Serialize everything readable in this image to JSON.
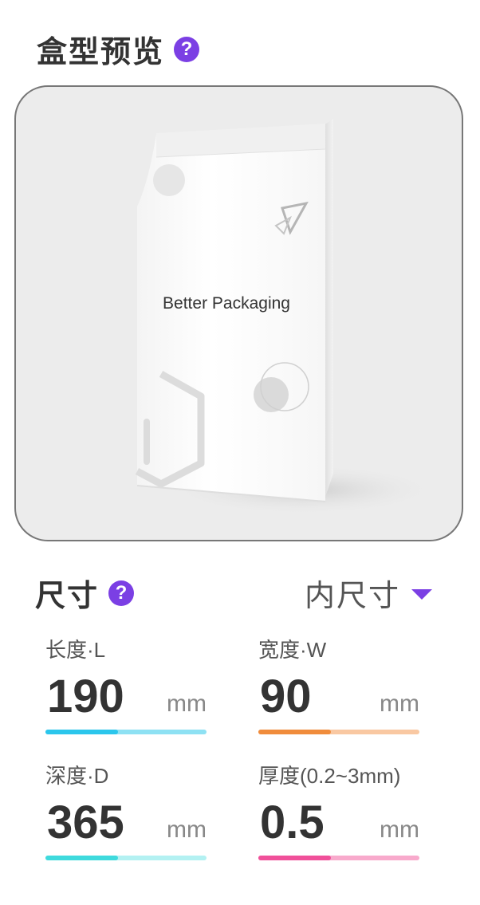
{
  "preview": {
    "title": "盒型预览",
    "help_glyph": "?",
    "product_label": "Better Packaging"
  },
  "size": {
    "title": "尺寸",
    "help_glyph": "?",
    "dimension_mode": "内尺寸"
  },
  "fields": {
    "length": {
      "label": "长度·L",
      "value": "190",
      "unit": "mm",
      "progress": 0.45,
      "color": "#2bc6ec",
      "track": "#8ee1f3"
    },
    "width": {
      "label": "宽度·W",
      "value": "90",
      "unit": "mm",
      "progress": 0.45,
      "color": "#f08c3c",
      "track": "#f9c8a2"
    },
    "depth": {
      "label": "深度·D",
      "value": "365",
      "unit": "mm",
      "progress": 0.45,
      "color": "#3fdadd",
      "track": "#b3f1f2"
    },
    "thickness": {
      "label": "厚度(0.2~3mm)",
      "value": "0.5",
      "unit": "mm",
      "progress": 0.45,
      "color": "#f0509a",
      "track": "#f8aacc"
    }
  },
  "colors": {
    "accent": "#7b3fe4"
  }
}
